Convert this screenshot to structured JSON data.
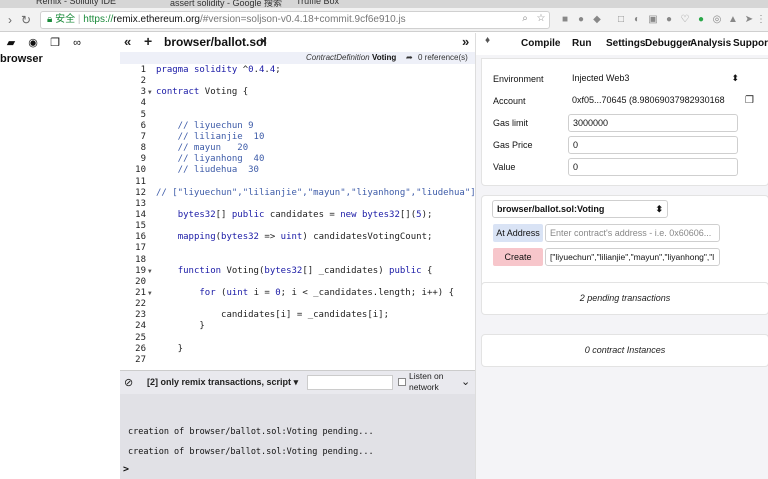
{
  "browser": {
    "tabs": [
      "Remix - Solidity IDE",
      "assert solidity - Google 搜索",
      "Truffle Box"
    ],
    "secure_label": "安全",
    "url_prefix": "https://",
    "url_host": "remix.ethereum.org",
    "url_rest": "/#version=soljson-v0.4.18+commit.9cf6e910.js"
  },
  "sidebar": {
    "title": "browser"
  },
  "editor": {
    "file_tab": "browser/ballot.sol",
    "close_glyph": "×",
    "context_label": "ContractDefinition",
    "context_name": "Voting",
    "references": "0 reference(s)",
    "lines": [
      {
        "n": "1",
        "text": "pragma solidity ^0.4.4;"
      },
      {
        "n": "2",
        "text": ""
      },
      {
        "n": "3",
        "text": "contract Voting {"
      },
      {
        "n": "4",
        "text": ""
      },
      {
        "n": "5",
        "text": ""
      },
      {
        "n": "6",
        "text": "    // liyuechun 9"
      },
      {
        "n": "7",
        "text": "    // lilianjie  10"
      },
      {
        "n": "8",
        "text": "    // mayun   20"
      },
      {
        "n": "9",
        "text": "    // liyanhong  40"
      },
      {
        "n": "10",
        "text": "    // liudehua  30"
      },
      {
        "n": "11",
        "text": ""
      },
      {
        "n": "12",
        "text": "// [\"liyuechun\",\"lilianjie\",\"mayun\",\"liyanhong\",\"liudehua\"]"
      },
      {
        "n": "13",
        "text": ""
      },
      {
        "n": "14",
        "text": "    bytes32[] public candidates = new bytes32[](5);"
      },
      {
        "n": "15",
        "text": ""
      },
      {
        "n": "16",
        "text": "    mapping(bytes32 => uint) candidatesVotingCount;"
      },
      {
        "n": "17",
        "text": ""
      },
      {
        "n": "18",
        "text": ""
      },
      {
        "n": "19",
        "text": "    function Voting(bytes32[] _candidates) public {"
      },
      {
        "n": "20",
        "text": ""
      },
      {
        "n": "21",
        "text": "        for (uint i = 0; i < _candidates.length; i++) {"
      },
      {
        "n": "22",
        "text": ""
      },
      {
        "n": "23",
        "text": "            candidates[i] = _candidates[i];"
      },
      {
        "n": "24",
        "text": "        }"
      },
      {
        "n": "25",
        "text": ""
      },
      {
        "n": "26",
        "text": "    }"
      },
      {
        "n": "27",
        "text": ""
      }
    ]
  },
  "terminal": {
    "filter_label": "[2] only remix transactions, script",
    "listen_label": "Listen on network",
    "log": [
      "creation of browser/ballot.sol:Voting pending...",
      "creation of browser/ballot.sol:Voting pending..."
    ],
    "prompt": ">"
  },
  "right": {
    "tabs": [
      "Compile",
      "Run",
      "Settings",
      "Debugger",
      "Analysis",
      "Support"
    ],
    "active_tab": "Run",
    "environment_label": "Environment",
    "environment_value": "Injected Web3",
    "account_label": "Account",
    "account_value": "0xf05...70645 (8.98069037982930168",
    "gas_limit_label": "Gas limit",
    "gas_limit_value": "3000000",
    "gas_price_label": "Gas Price",
    "gas_price_value": "0",
    "value_label": "Value",
    "value_value": "0",
    "contract_select": "browser/ballot.sol:Voting",
    "at_address_button": "At Address",
    "at_address_placeholder": "Enter contract's address - i.e. 0x60606...",
    "create_button": "Create",
    "create_args": "[\"liyuechun\",\"lilianjie\",\"mayun\",\"liyanhong\",\"l",
    "pending_transactions": "2 pending transactions",
    "contract_instances": "0 contract Instances"
  },
  "colors": {
    "create_button": "#f7c6cb",
    "at_address_button": "#d9e3f5",
    "terminal_bg": "#e1e1e6"
  }
}
